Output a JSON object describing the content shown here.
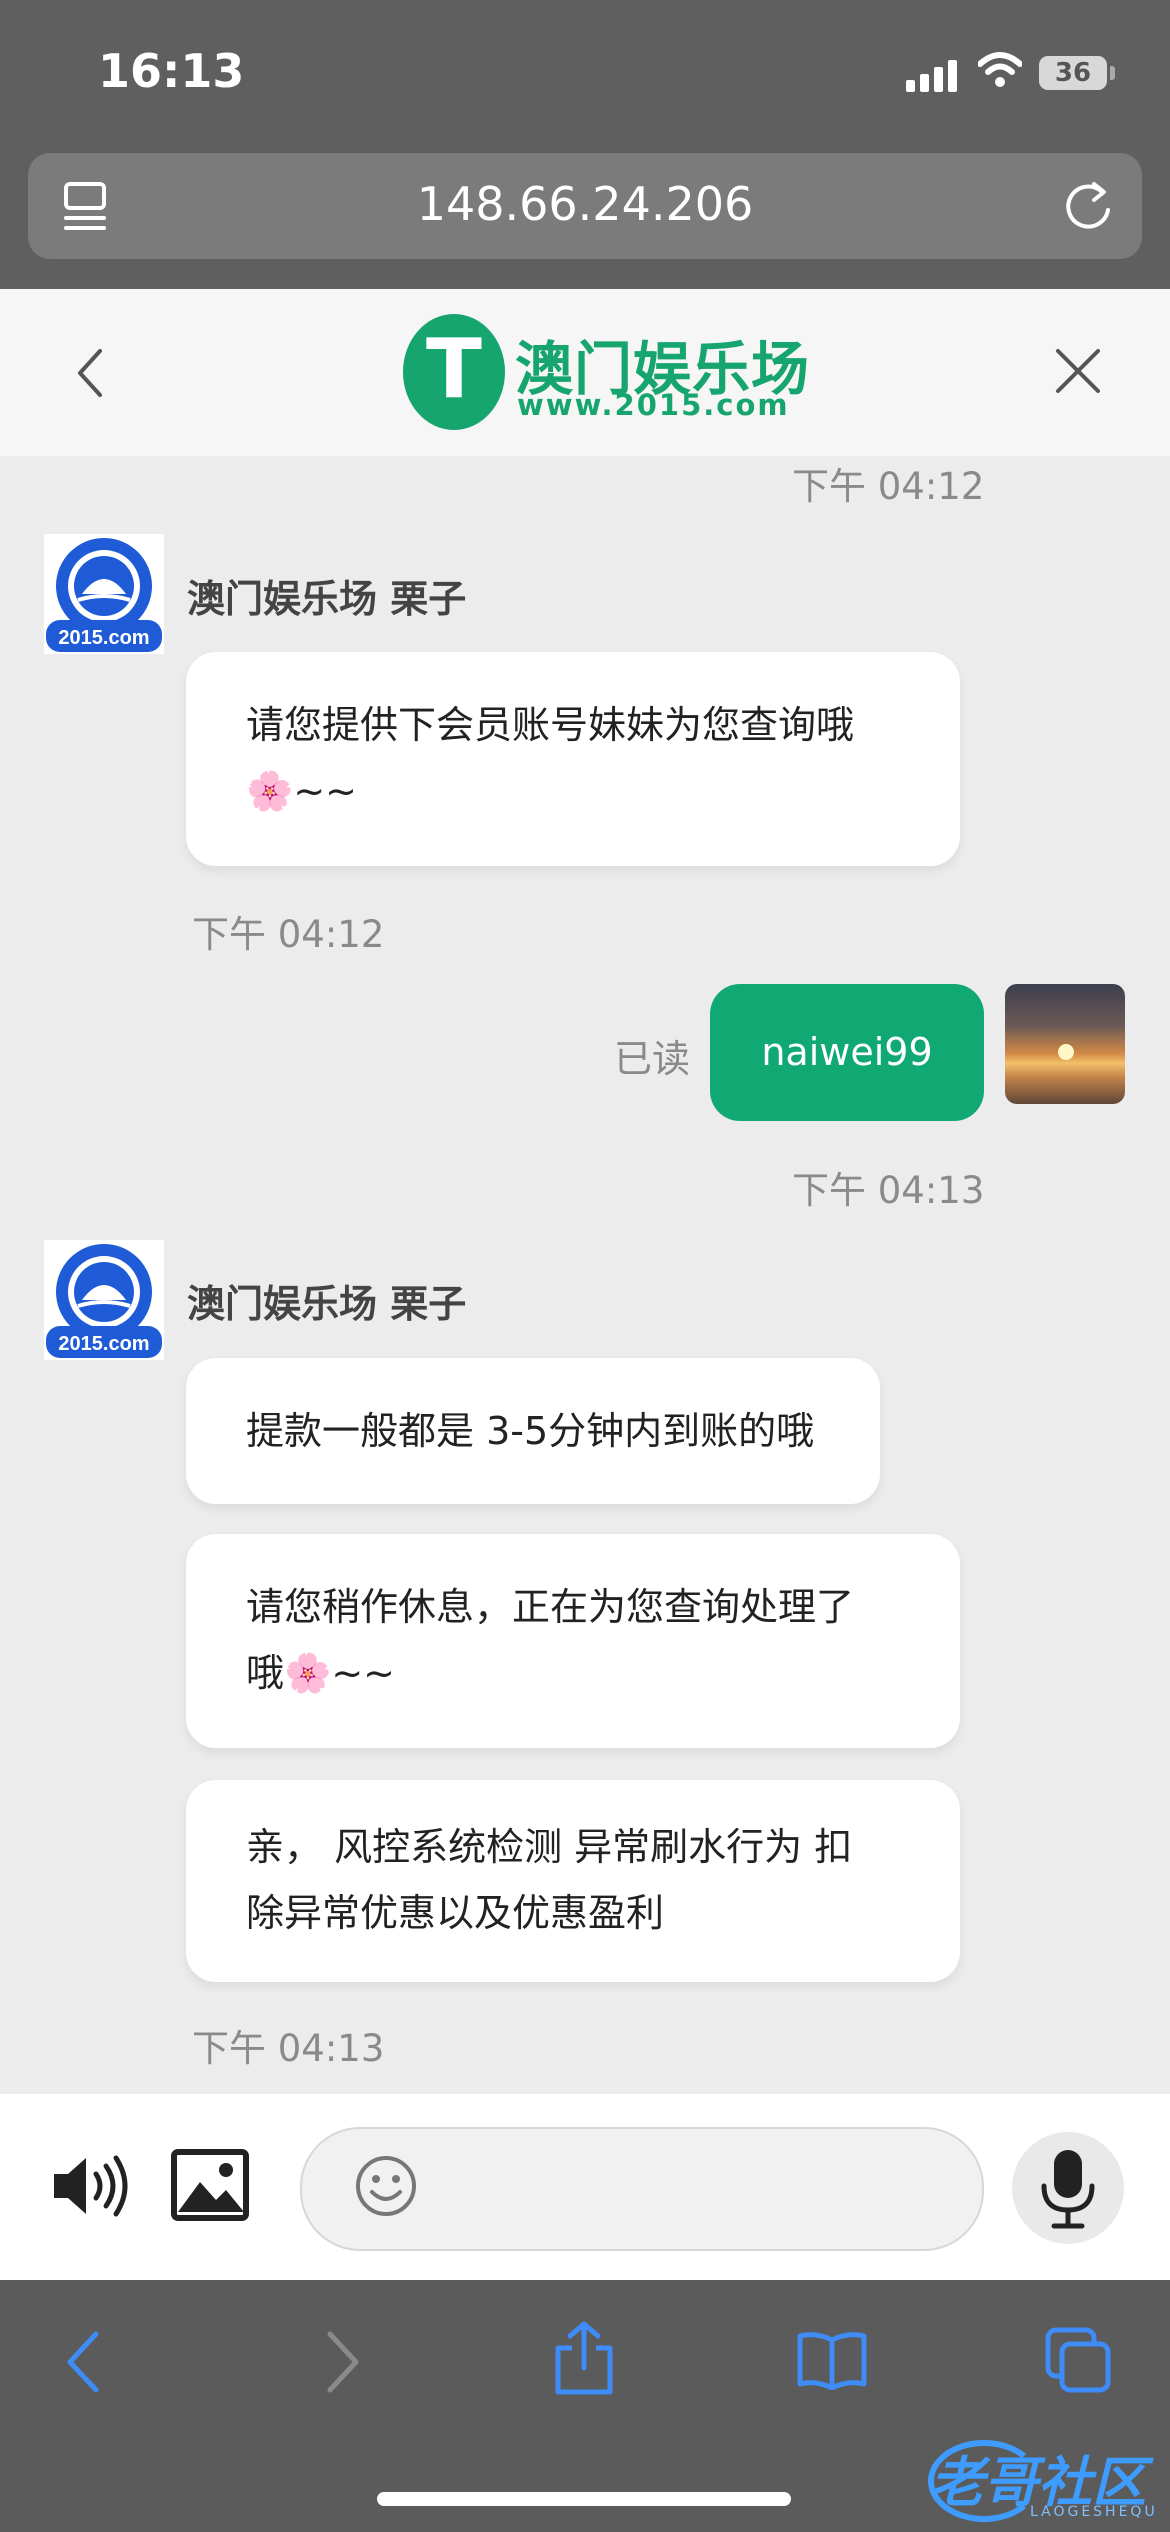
{
  "status_bar": {
    "time": "16:13",
    "battery": "36"
  },
  "browser": {
    "url": "148.66.24.206"
  },
  "header": {
    "logo_title": "澳门娱乐场",
    "logo_sub": "www.2015.com",
    "logo_mark": "T"
  },
  "avatar_text": "2015.com",
  "messages": [
    {
      "timestamp": "下午 04:12"
    },
    {
      "sender": "澳门娱乐场 栗子",
      "lines": [
        "请您提供下会员账号妹妹为您查询哦",
        "🌸~~"
      ],
      "timestamp": "下午 04:12"
    },
    {
      "mine_text": "naiwei99",
      "read_label": "已读",
      "timestamp": "下午 04:13"
    },
    {
      "sender": "澳门娱乐场 栗子",
      "bubbles": [
        {
          "lines": [
            "提款一般都是 3-5分钟内到账的哦"
          ]
        },
        {
          "lines": [
            "请您稍作休息，正在为您查询处理了",
            "哦🌸~~"
          ]
        },
        {
          "lines": [
            "亲， 风控系统检测 异常刷水行为 扣",
            "除异常优惠以及优惠盈利"
          ]
        }
      ],
      "timestamp": "下午 04:13"
    }
  ],
  "composer": {
    "icons": [
      "speaker-icon",
      "image-icon",
      "emoji-icon",
      "microphone-icon"
    ]
  },
  "toolbar": {
    "icons": [
      "back-icon",
      "forward-icon",
      "share-icon",
      "bookmarks-icon",
      "tabs-icon"
    ]
  },
  "watermark": {
    "text": "老哥社区",
    "sub": "LAOGESHEQU"
  },
  "colors": {
    "accent_green": "#10a873",
    "safari_blue": "#3e8cf7",
    "brand_green": "#17a56f"
  }
}
